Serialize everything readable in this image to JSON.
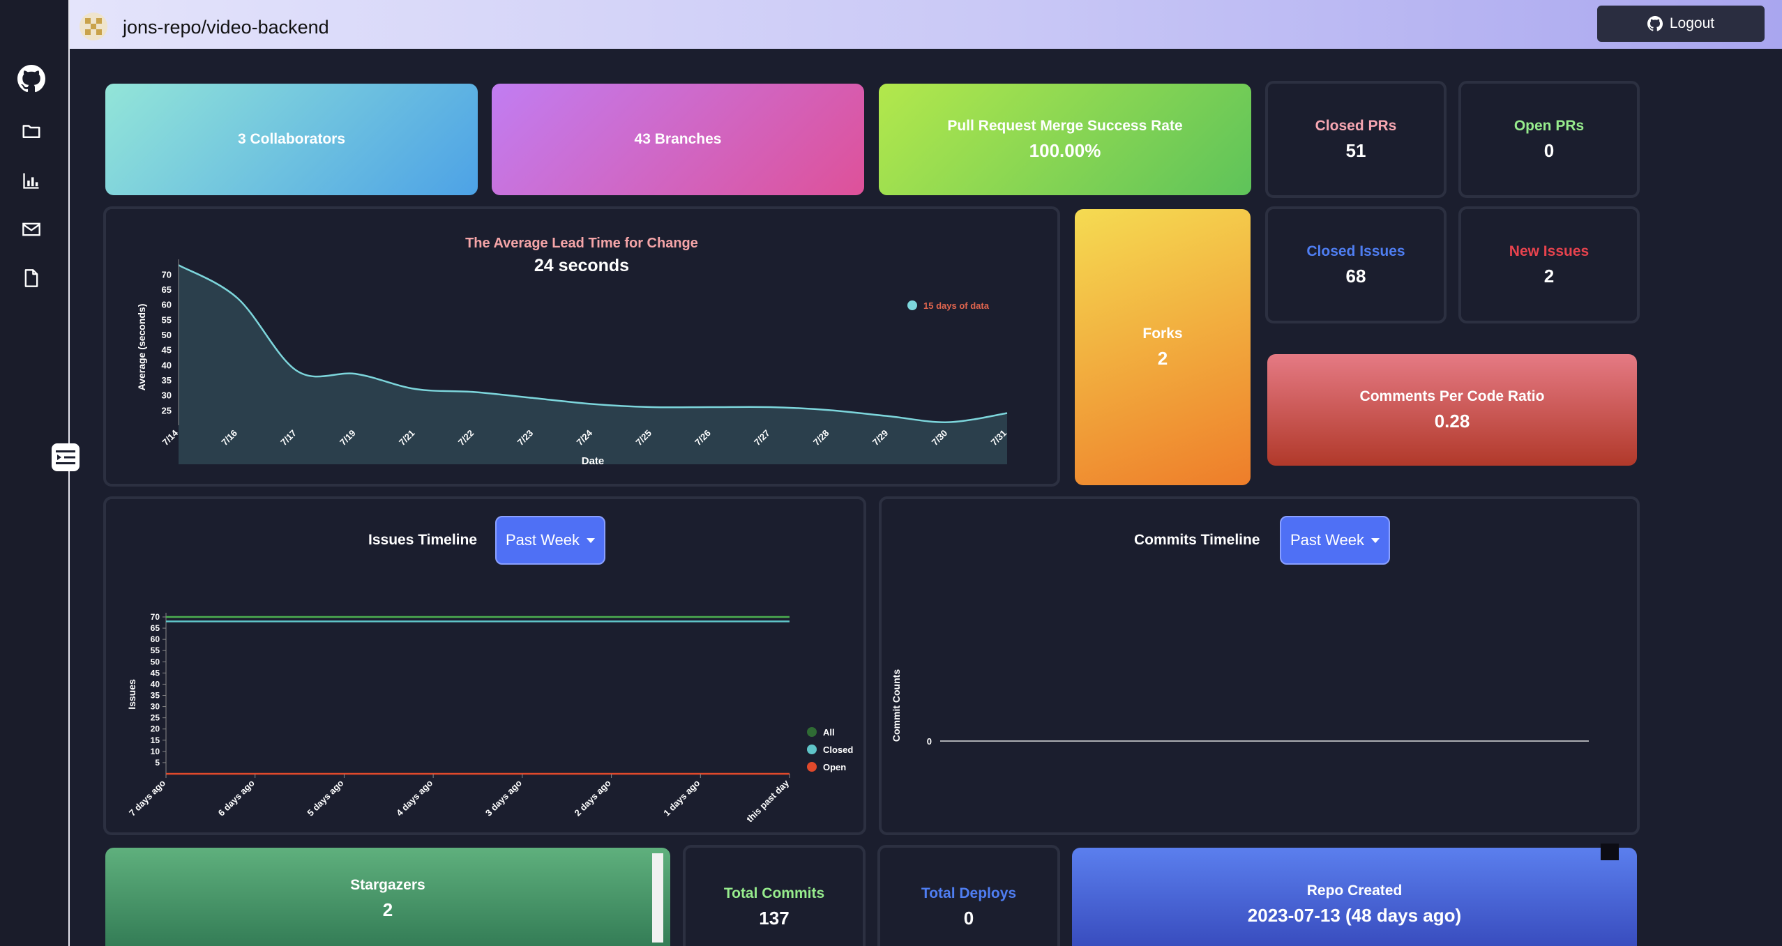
{
  "header": {
    "repo_name": "jons-repo/video-backend",
    "logout_label": "Logout"
  },
  "stats": {
    "collaborators": "3 Collaborators",
    "branches": "43 Branches",
    "merge_rate_label": "Pull Request Merge Success Rate",
    "merge_rate_value": "100.00%",
    "closed_prs_label": "Closed PRs",
    "closed_prs_value": "51",
    "open_prs_label": "Open PRs",
    "open_prs_value": "0",
    "closed_issues_label": "Closed Issues",
    "closed_issues_value": "68",
    "new_issues_label": "New Issues",
    "new_issues_value": "2",
    "forks_label": "Forks",
    "forks_value": "2",
    "comments_ratio_label": "Comments Per Code Ratio",
    "comments_ratio_value": "0.28",
    "stargazers_label": "Stargazers",
    "stargazers_value": "2",
    "total_commits_label": "Total Commits",
    "total_commits_value": "137",
    "total_deploys_label": "Total Deploys",
    "total_deploys_value": "0",
    "repo_created_label": "Repo Created",
    "repo_created_value": "2023-07-13 (48 days ago)"
  },
  "lead_time": {
    "title": "The Average Lead Time for Change",
    "value": "24 seconds"
  },
  "issues_timeline": {
    "title": "Issues Timeline",
    "filter": "Past Week"
  },
  "commits_timeline": {
    "title": "Commits Timeline",
    "filter": "Past Week"
  },
  "colors": {
    "lead_line": "#7dd6dc",
    "lead_fill": "#2b3f4c",
    "all": "#4caf50",
    "closed": "#5fc4c8",
    "open": "#e0492b"
  },
  "icons": [
    "github-icon",
    "folder-icon",
    "bar-chart-icon",
    "mail-icon",
    "file-icon",
    "menu-toggle-icon"
  ],
  "chart_data": [
    {
      "type": "area",
      "title": "The Average Lead Time for Change",
      "xlabel": "Date",
      "ylabel": "Average (seconds)",
      "x": [
        "7/14",
        "7/16",
        "7/17",
        "7/19",
        "7/21",
        "7/22",
        "7/23",
        "7/24",
        "7/25",
        "7/26",
        "7/27",
        "7/28",
        "7/29",
        "7/30",
        "7/31"
      ],
      "y_ticks": [
        25,
        30,
        35,
        40,
        45,
        50,
        55,
        60,
        65,
        70
      ],
      "series": [
        {
          "name": "15 days of data",
          "values": [
            73,
            62,
            38,
            37,
            32,
            31,
            29,
            27,
            26,
            26,
            26,
            25,
            23,
            21,
            24
          ]
        }
      ]
    },
    {
      "type": "line",
      "xlabel": "",
      "ylabel": "Issues",
      "x": [
        "7 days ago",
        "6 days ago",
        "5 days ago",
        "4 days ago",
        "3 days ago",
        "2 days ago",
        "1 days ago",
        "this past day"
      ],
      "y_ticks": [
        5,
        10,
        15,
        20,
        25,
        30,
        35,
        40,
        45,
        50,
        55,
        60,
        65,
        70
      ],
      "ylim": [
        0,
        70
      ],
      "series": [
        {
          "name": "All",
          "values": [
            70,
            70,
            70,
            70,
            70,
            70,
            70,
            70
          ]
        },
        {
          "name": "Closed",
          "values": [
            68,
            68,
            68,
            68,
            68,
            68,
            68,
            68
          ]
        },
        {
          "name": "Open",
          "values": [
            0,
            0,
            0,
            0,
            0,
            0,
            0,
            0
          ]
        }
      ]
    },
    {
      "type": "line",
      "ylabel": "Commit Counts",
      "y_ticks": [
        0
      ],
      "series": [
        {
          "values": [
            0
          ]
        }
      ]
    }
  ]
}
